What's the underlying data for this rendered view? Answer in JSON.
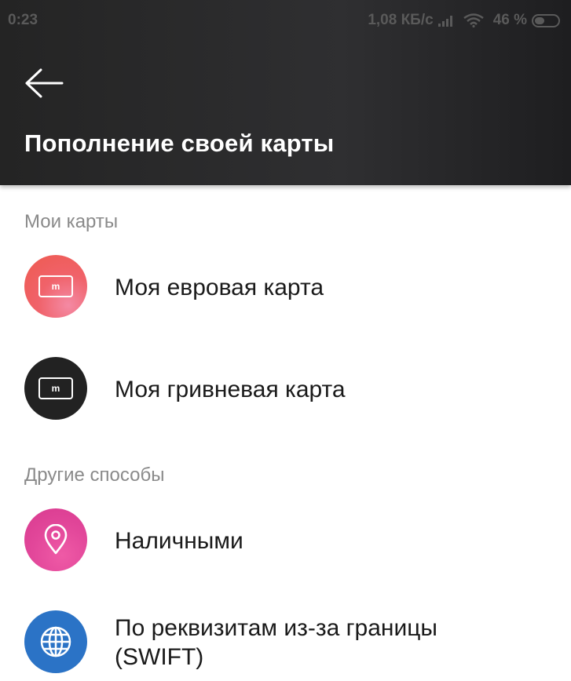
{
  "status": {
    "time": "0:23",
    "speed": "1,08 КБ/с",
    "battery": "46 %"
  },
  "header": {
    "back_icon": "arrow-left-icon",
    "title": "Пополнение своей карты"
  },
  "sections": {
    "my_cards": "Мои карты",
    "other_methods": "Другие способы"
  },
  "items": {
    "euro_card": {
      "label": "Моя евровая карта",
      "icon": "card-icon",
      "glyph": "m",
      "color": "#f0626a"
    },
    "uah_card": {
      "label": "Моя гривневая карта",
      "icon": "card-icon",
      "glyph": "m",
      "color": "#222222"
    },
    "cash": {
      "label": "Наличными",
      "icon": "location-pin-icon",
      "color": "#e2479a"
    },
    "swift": {
      "label_line1": "По реквизитам из-за границы",
      "label_line2": "(SWIFT)",
      "icon": "globe-icon",
      "color": "#2b73c6"
    }
  }
}
